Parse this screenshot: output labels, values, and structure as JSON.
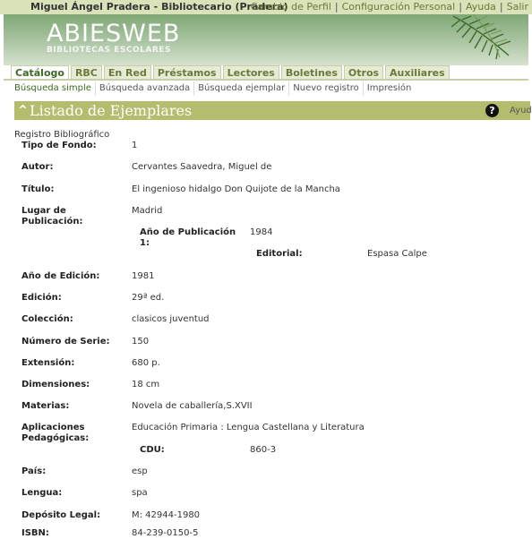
{
  "topbar": {
    "user": "Miguel Ángel Pradera - Bibliotecario (Pradera)",
    "links": [
      "Cambio de Perfil",
      "Configuración Personal",
      "Ayuda",
      "Salir"
    ]
  },
  "header": {
    "logo_main": "ABIESWEB",
    "logo_sub": "BIBLIOTECAS ESCOLARES"
  },
  "tabs": [
    "Catálogo",
    "RBC",
    "En Red",
    "Préstamos",
    "Lectores",
    "Boletines",
    "Otros",
    "Auxiliares"
  ],
  "subnav": [
    "Búsqueda simple",
    "Búsqueda avanzada",
    "Búsqueda ejemplar",
    "Nuevo registro",
    "Impresión"
  ],
  "section": {
    "title": "Listado de Ejemplares",
    "help_label": "Ayuda"
  },
  "record": {
    "label": "Registro Bibliográfico",
    "tipo_fondo": {
      "k": "Tipo de Fondo:",
      "v": "1"
    },
    "autor": {
      "k": "Autor:",
      "v": "Cervantes Saavedra, Miguel de"
    },
    "titulo": {
      "k": "Título:",
      "v": "El ingenioso hidalgo Don Quijote de la Mancha"
    },
    "lugar": {
      "k": "Lugar de Publicación:",
      "v": "Madrid"
    },
    "anio_pub": {
      "k": "Año de Publicación 1:",
      "v": "1984"
    },
    "editorial": {
      "k": "Editorial:",
      "v": "Espasa Calpe"
    },
    "anio_ed": {
      "k": "Año de Edición:",
      "v": "1981"
    },
    "edicion": {
      "k": "Edición:",
      "v": "29ª ed."
    },
    "coleccion": {
      "k": "Colección:",
      "v": "clasicos juventud"
    },
    "num_serie": {
      "k": "Número de Serie:",
      "v": "150"
    },
    "extension": {
      "k": "Extensión:",
      "v": "680 p."
    },
    "dimensiones": {
      "k": "Dimensiones:",
      "v": "18 cm"
    },
    "materias": {
      "k": "Materias:",
      "v": "Novela de caballería,S.XVII"
    },
    "aplicaciones": {
      "k": "Aplicaciones Pedagógicas:",
      "v": "Educación Primaria : Lengua Castellana y Literatura"
    },
    "cdu": {
      "k": "CDU:",
      "v": "860-3"
    },
    "pais": {
      "k": "País:",
      "v": "esp"
    },
    "lengua": {
      "k": "Lengua:",
      "v": "spa"
    },
    "deposito": {
      "k": "Depósito Legal:",
      "v": "M: 42944-1980"
    },
    "isbn": {
      "k": "ISBN:",
      "v": "84-239-0150-5"
    }
  },
  "colors": {
    "accent": "#b4bd6e",
    "header_green": "#7fa876",
    "topbar": "#d9e2b8",
    "link": "#6a7a3a"
  }
}
